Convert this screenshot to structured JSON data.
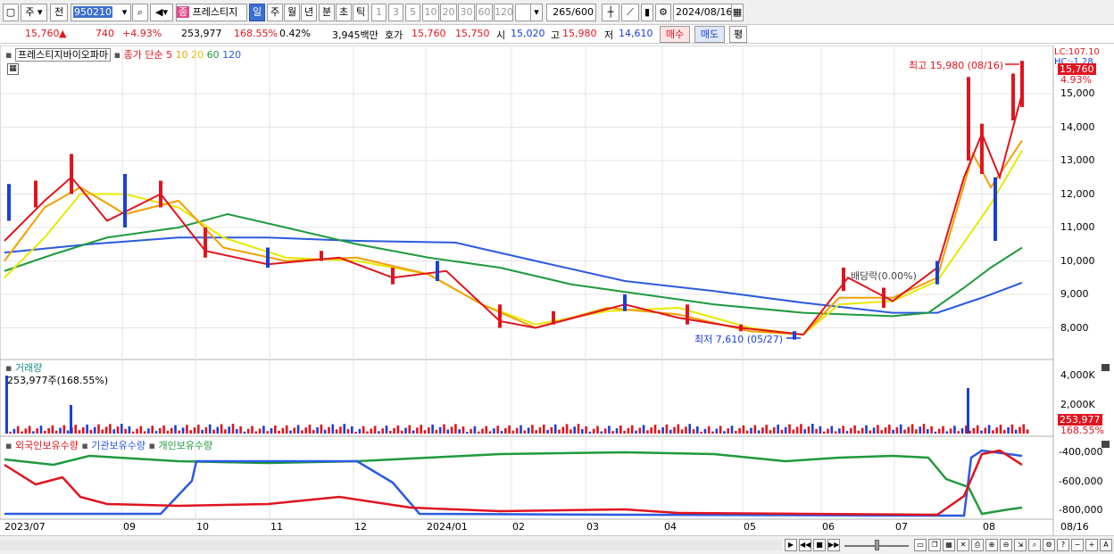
{
  "toolbar": {
    "market": "주",
    "type": "전",
    "code": "950210",
    "name": "프레스티지",
    "periods": [
      "일",
      "주",
      "월",
      "년",
      "분",
      "초",
      "틱"
    ],
    "active_period": "일",
    "intervals": [
      "1",
      "3",
      "5",
      "10",
      "20",
      "30",
      "60",
      "120"
    ],
    "count": "265",
    "count_max": "/600",
    "date": "2024/08/16",
    "jong_badge": "종"
  },
  "quote": {
    "price": "15,760",
    "arrow": "▲",
    "change": "740",
    "change_pct": "+4.93%",
    "volume": "253,977",
    "volume_ratio": "168.55%",
    "turnover": "0.42%",
    "amount": "3,945백만",
    "hoga_label": "호가",
    "ask": "15,760",
    "bid": "15,750",
    "open_label": "시",
    "open": "15,020",
    "high_label": "고",
    "high": "15,980",
    "low_label": "저",
    "low": "14,610",
    "buy_label": "매수",
    "sell_label": "매도",
    "eval_label": "평"
  },
  "price_panel": {
    "title": "프레스티지바이오파마",
    "ma_label": "종가 단순",
    "ma_periods": [
      "5",
      "10",
      "20",
      "60",
      "120"
    ],
    "ma_colors": [
      "#e0141e",
      "#f0a000",
      "#e8e800",
      "#1e9a3c",
      "#2a5ae0"
    ],
    "lc": "LC:107.10",
    "hc": "HC:-1.28",
    "y_ticks": [
      "15,000",
      "14,000",
      "13,000",
      "12,000",
      "11,000",
      "10,000",
      "9,000",
      "8,000"
    ],
    "cur_price": "15,760",
    "cur_pct": "4.93%",
    "high_ann": "최고 15,980 (08/16)",
    "low_ann": "최저 7,610 (05/27)",
    "div_ann": "배당락(0.00%)"
  },
  "volume_panel": {
    "title": "거래량",
    "value": "253,977주(168.55%)",
    "y_ticks": [
      "4,000K",
      "2,000K"
    ],
    "cur": "253,977",
    "cur_pct": "168.55%"
  },
  "holdings_panel": {
    "series": [
      {
        "name": "외국인보유수량",
        "color": "#e0141e"
      },
      {
        "name": "기관보유수량",
        "color": "#2a5ae0"
      },
      {
        "name": "개인보유수량",
        "color": "#1e9a3c"
      }
    ],
    "y_ticks": [
      "-400,000",
      "-600,000",
      "-800,000"
    ]
  },
  "x_axis": [
    "2023/07",
    "09",
    "10",
    "11",
    "12",
    "2024/01",
    "02",
    "03",
    "04",
    "05",
    "06",
    "07",
    "08",
    "08/16"
  ]
}
